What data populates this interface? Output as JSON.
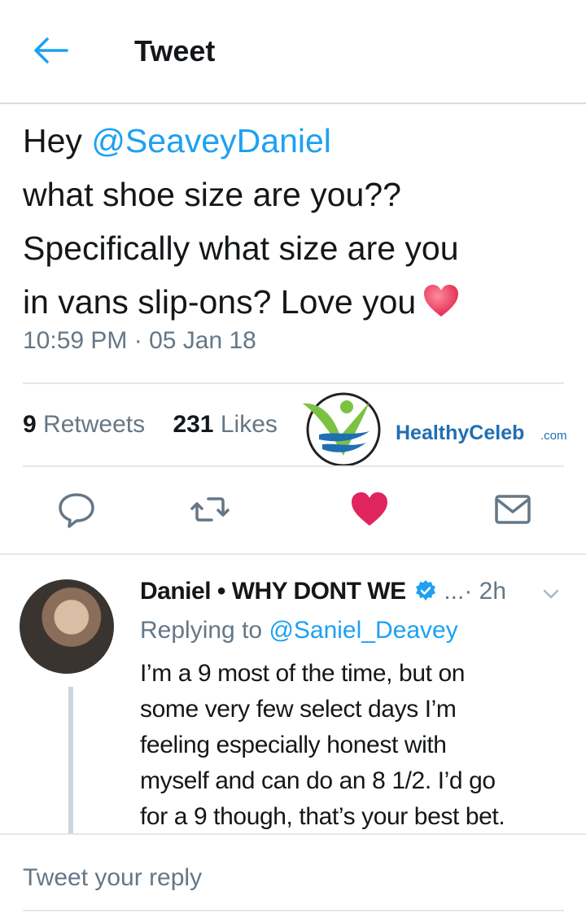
{
  "header": {
    "title": "Tweet",
    "back_icon": "back-arrow-icon"
  },
  "tweet": {
    "line1_prefix": "Hey ",
    "mention": "@SeaveyDaniel",
    "line2": "what shoe size are you??",
    "line3": "Specifically what size are you",
    "line4": "in vans slip-ons? Love you",
    "emoji": "red-heart-emoji",
    "timestamp": "10:59 PM · 05 Jan 18",
    "retweets_count": "9",
    "retweets_label": "Retweets",
    "likes_count": "231",
    "likes_label": "Likes"
  },
  "watermark": {
    "text": "HealthyCeleb",
    "suffix": ".com",
    "colors": {
      "blue": "#1f6fb3",
      "green": "#7cc242"
    }
  },
  "actions": [
    {
      "icon": "reply-icon"
    },
    {
      "icon": "retweet-icon"
    },
    {
      "icon": "like-heart-icon",
      "liked": true,
      "color": "#e0245e"
    },
    {
      "icon": "direct-message-icon"
    }
  ],
  "reply": {
    "name": "Daniel • WHY DONT WE",
    "verified": true,
    "meta": " ...· 2h",
    "replying_prefix": "Replying to ",
    "replying_to": "@Saniel_Deavey",
    "lines": [
      "I’m a 9 most of the time, but on",
      "some very few select days I’m",
      "feeling especially honest with",
      "myself and can do an 8 1/2. I’d go",
      "for a 9 though, that’s your best bet."
    ]
  },
  "composer": {
    "placeholder": "Tweet your reply"
  },
  "colors": {
    "accent": "#1da1f2",
    "secondary_text": "#657786",
    "text": "#14171a"
  }
}
